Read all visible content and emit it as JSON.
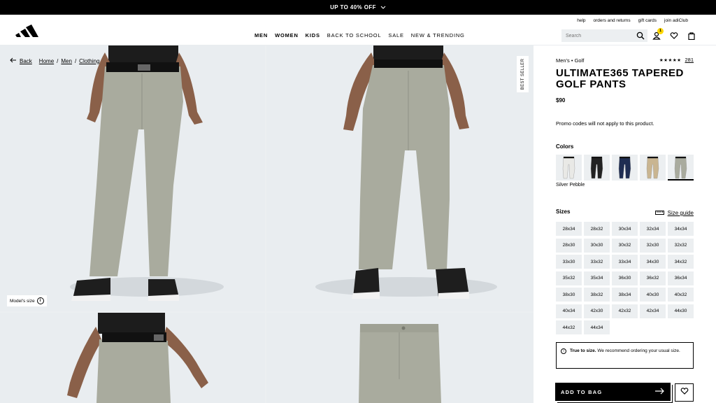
{
  "promo_bar": {
    "text": "UP TO 40% OFF"
  },
  "header": {
    "utility_links": [
      "help",
      "orders and returns",
      "gift cards",
      "join adiClub"
    ],
    "nav": [
      {
        "label": "MEN",
        "bold": true
      },
      {
        "label": "WOMEN",
        "bold": true
      },
      {
        "label": "KIDS",
        "bold": true
      },
      {
        "label": "BACK TO SCHOOL",
        "bold": false
      },
      {
        "label": "SALE",
        "bold": false
      },
      {
        "label": "NEW & TRENDING",
        "bold": false
      }
    ],
    "search_placeholder": "Search",
    "account_badge": "1"
  },
  "gallery": {
    "back_label": "Back",
    "breadcrumb": [
      "Home",
      "Men",
      "Clothing"
    ],
    "badge": "BEST SELLER",
    "model_size_label": "Model's size",
    "icons": [
      "back-arrow-icon",
      "info-icon"
    ]
  },
  "product": {
    "category": "Men's • Golf",
    "rating_stars": "★★★★★",
    "rating": 5,
    "review_count": "281",
    "title": "ULTIMATE365 TAPERED GOLF PANTS",
    "price": "$90",
    "promo_note": "Promo codes will not apply to this product.",
    "colors_heading": "Colors",
    "colors": [
      {
        "hex": "#e9e9e6"
      },
      {
        "hex": "#222222"
      },
      {
        "hex": "#1f2d52"
      },
      {
        "hex": "#c9b591"
      },
      {
        "hex": "#a9ab9e",
        "selected": true
      }
    ],
    "selected_color": "Silver Pebble",
    "sizes_heading": "Sizes",
    "size_guide": "Size guide",
    "sizes": [
      "28x34",
      "28x32",
      "30x34",
      "32x34",
      "34x34",
      "28x30",
      "30x30",
      "30x32",
      "32x30",
      "32x32",
      "33x30",
      "33x32",
      "33x34",
      "34x30",
      "34x32",
      "35x32",
      "35x34",
      "36x30",
      "36x32",
      "36x34",
      "38x30",
      "38x32",
      "38x34",
      "40x30",
      "40x32",
      "40x34",
      "42x30",
      "42x32",
      "42x34",
      "44x30",
      "44x32",
      "44x34"
    ],
    "fit_bold": "True to size.",
    "fit_text": " We recommend ordering your usual size.",
    "add_to_bag": "ADD TO BAG"
  },
  "theme": {
    "accent": "#000000",
    "badge_color": "#ffd700",
    "background": "#eceff1",
    "pant_color": "#a9ab9e"
  }
}
